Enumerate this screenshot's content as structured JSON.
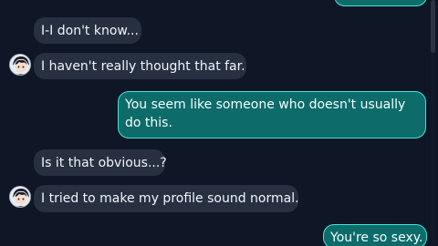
{
  "messages": [
    {
      "side": "out",
      "text": ""
    },
    {
      "side": "in",
      "text": "I-I don't know..."
    },
    {
      "side": "in",
      "text": "I haven't really thought that far.",
      "avatar": "character-avatar-icon"
    },
    {
      "side": "out",
      "text": "You seem like someone who doesn't usually do this."
    },
    {
      "side": "in",
      "text": "Is it that obvious...?"
    },
    {
      "side": "in",
      "text": "I tried to make my profile sound normal.",
      "avatar": "character-avatar-icon"
    },
    {
      "side": "out",
      "text": "You're so sexy."
    }
  ],
  "colors": {
    "background": "#0f1625",
    "incoming_bubble": "#263040",
    "outgoing_bubble": "#0d6b6a",
    "outgoing_border": "#3fe6d8"
  }
}
